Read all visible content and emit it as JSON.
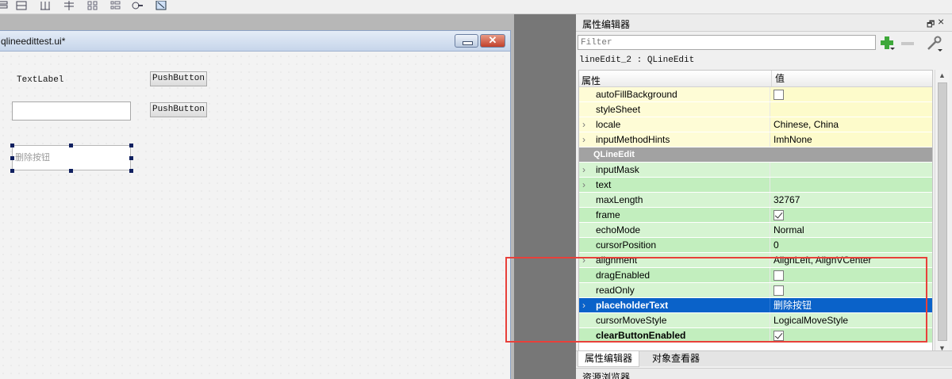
{
  "toolbar": {
    "icons": [
      "layout-vertical-icon",
      "layout-horizontal-icon",
      "splitter-horizontal-icon",
      "splitter-vertical-icon",
      "grid-layout-icon",
      "form-layout-icon",
      "break-layout-icon",
      "adjust-size-icon"
    ]
  },
  "form_window": {
    "title": "qlineedittest.ui*",
    "close_glyph": "✕",
    "widgets": {
      "text_label": "TextLabel",
      "push_button_1": "PushButton",
      "push_button_2": "PushButton",
      "line_edit_placeholder": "删除按钮"
    }
  },
  "property_editor": {
    "title": "属性编辑器",
    "float_glyph": "🗗",
    "close_glyph": "×",
    "filter_placeholder": "Filter",
    "object_name": "lineEdit_2 : QLineEdit",
    "columns": {
      "property": "属性",
      "value": "值"
    },
    "rows": [
      {
        "name": "autoFillBackground",
        "value": "",
        "checkbox": "unchecked",
        "expand": false,
        "style": "yellow"
      },
      {
        "name": "styleSheet",
        "value": "",
        "checkbox": "none",
        "expand": false,
        "style": "yellow"
      },
      {
        "name": "locale",
        "value": "Chinese, China",
        "checkbox": "none",
        "expand": true,
        "style": "yellow"
      },
      {
        "name": "inputMethodHints",
        "value": "ImhNone",
        "checkbox": "none",
        "expand": true,
        "style": "yellow"
      },
      {
        "name": "QLineEdit",
        "value": "",
        "checkbox": "none",
        "expand": false,
        "style": "section"
      },
      {
        "name": "inputMask",
        "value": "",
        "checkbox": "none",
        "expand": true,
        "style": "green"
      },
      {
        "name": "text",
        "value": "",
        "checkbox": "none",
        "expand": true,
        "style": "green-alt"
      },
      {
        "name": "maxLength",
        "value": "32767",
        "checkbox": "none",
        "expand": false,
        "style": "green"
      },
      {
        "name": "frame",
        "value": "",
        "checkbox": "checked",
        "expand": false,
        "style": "green-alt"
      },
      {
        "name": "echoMode",
        "value": "Normal",
        "checkbox": "none",
        "expand": false,
        "style": "green"
      },
      {
        "name": "cursorPosition",
        "value": "0",
        "checkbox": "none",
        "expand": false,
        "style": "green-alt"
      },
      {
        "name": "alignment",
        "value": "AlignLeft, AlignVCenter",
        "checkbox": "none",
        "expand": true,
        "style": "green"
      },
      {
        "name": "dragEnabled",
        "value": "",
        "checkbox": "unchecked",
        "expand": false,
        "style": "green-alt"
      },
      {
        "name": "readOnly",
        "value": "",
        "checkbox": "unchecked",
        "expand": false,
        "style": "green"
      },
      {
        "name": "placeholderText",
        "value": "删除按钮",
        "checkbox": "none",
        "expand": true,
        "style": "selected",
        "bold": true
      },
      {
        "name": "cursorMoveStyle",
        "value": "LogicalMoveStyle",
        "checkbox": "none",
        "expand": false,
        "style": "green"
      },
      {
        "name": "clearButtonEnabled",
        "value": "",
        "checkbox": "checked",
        "expand": false,
        "style": "green-alt",
        "bold": true
      }
    ],
    "tabs": [
      {
        "label": "属性编辑器",
        "active": true
      },
      {
        "label": "对象查看器",
        "active": false
      }
    ]
  },
  "resource_browser": {
    "title": "资源浏览器"
  }
}
